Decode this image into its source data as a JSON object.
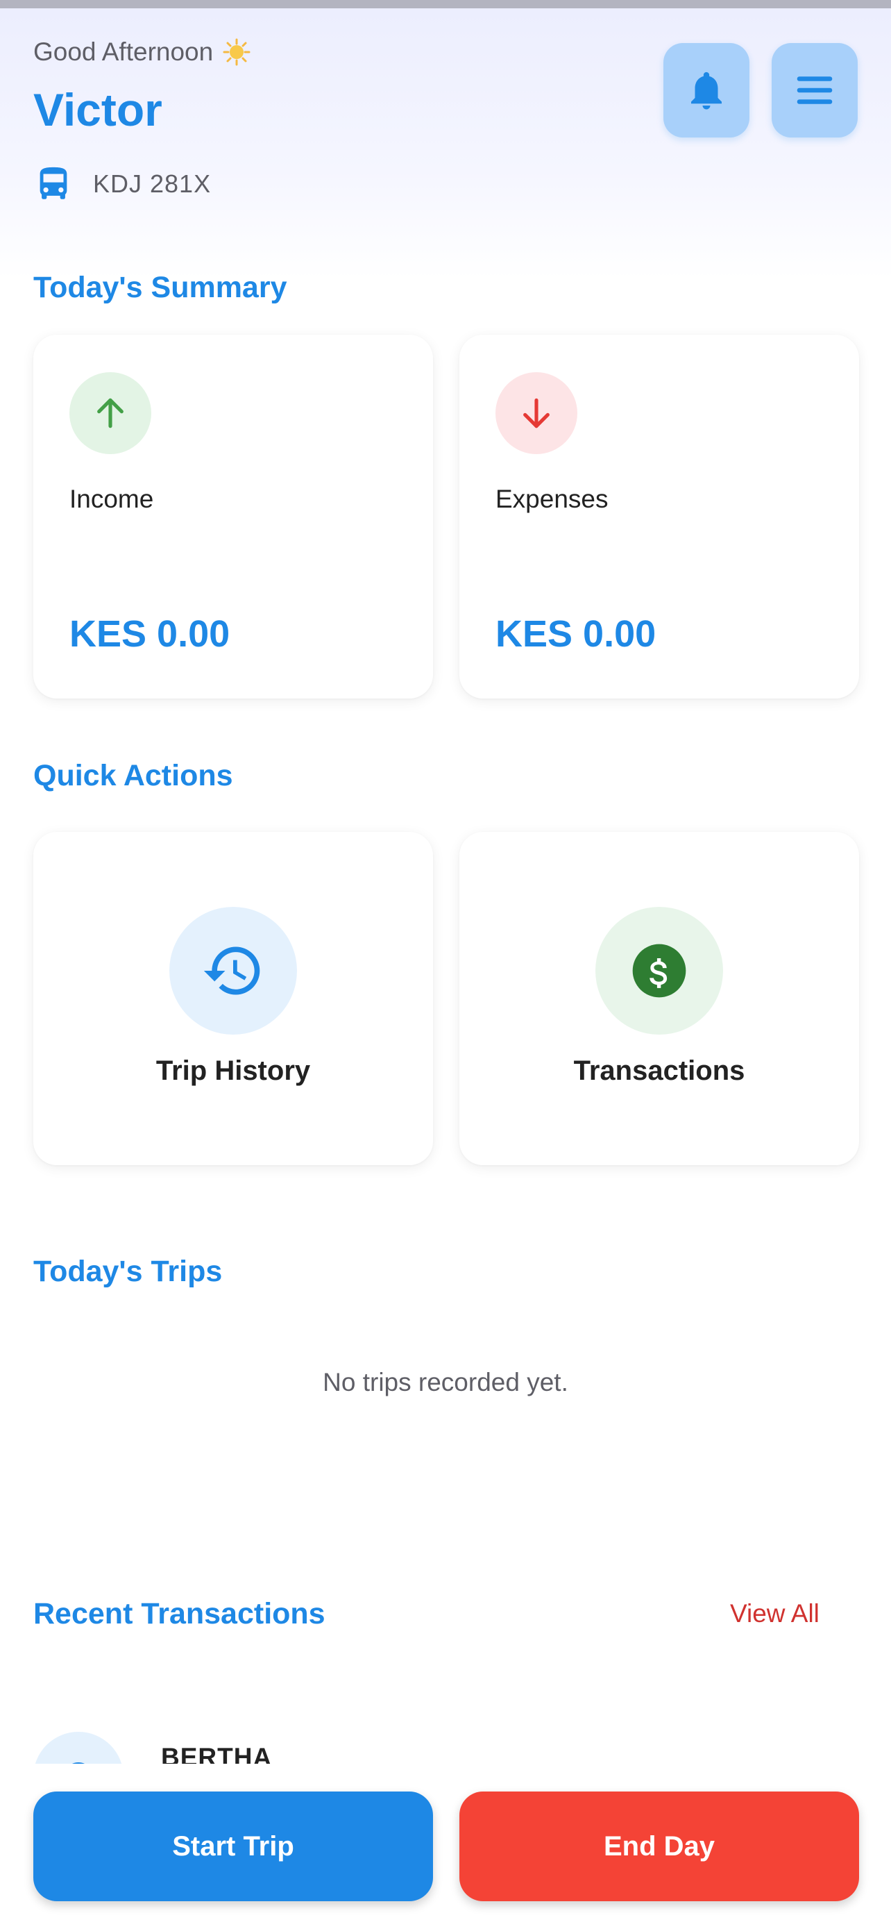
{
  "header": {
    "greeting": "Good Afternoon",
    "greeting_emoji_icon": "sun-emoji-icon",
    "name": "Victor",
    "vehicle_icon": "bus-icon",
    "plate": "KDJ 281X",
    "notification_icon": "bell-icon",
    "menu_icon": "menu-icon"
  },
  "summary": {
    "title": "Today's Summary",
    "income": {
      "label": "Income",
      "amount": "KES 0.00",
      "icon": "arrow-up-icon",
      "color": "#43a047"
    },
    "expenses": {
      "label": "Expenses",
      "amount": "KES 0.00",
      "icon": "arrow-down-icon",
      "color": "#e53935"
    }
  },
  "quick_actions": {
    "title": "Quick Actions",
    "items": [
      {
        "label": "Trip History",
        "icon": "history-icon"
      },
      {
        "label": "Transactions",
        "icon": "dollar-icon"
      }
    ]
  },
  "trips": {
    "title": "Today's Trips",
    "empty_text": "No trips recorded yet."
  },
  "transactions": {
    "title": "Recent Transactions",
    "view_all": "View All",
    "items": [
      {
        "name": "BERTHA"
      }
    ]
  },
  "bottom_actions": {
    "start": "Start Trip",
    "end": "End Day"
  },
  "colors": {
    "accent": "#1e88e5",
    "danger": "#f44336",
    "link_red": "#d0322f"
  }
}
